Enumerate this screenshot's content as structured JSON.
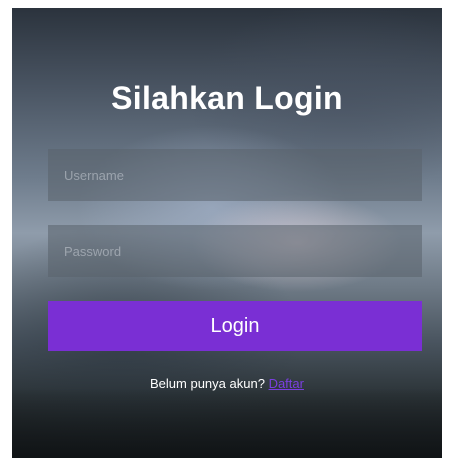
{
  "login_form": {
    "title": "Silahkan Login",
    "username_placeholder": "Username",
    "password_placeholder": "Password",
    "login_button_label": "Login",
    "signup_prompt": "Belum punya akun?",
    "signup_link_label": "Daftar"
  },
  "colors": {
    "button_background": "#7a2fd4",
    "link_color": "#7a3fe0",
    "title_color": "#ffffff"
  }
}
